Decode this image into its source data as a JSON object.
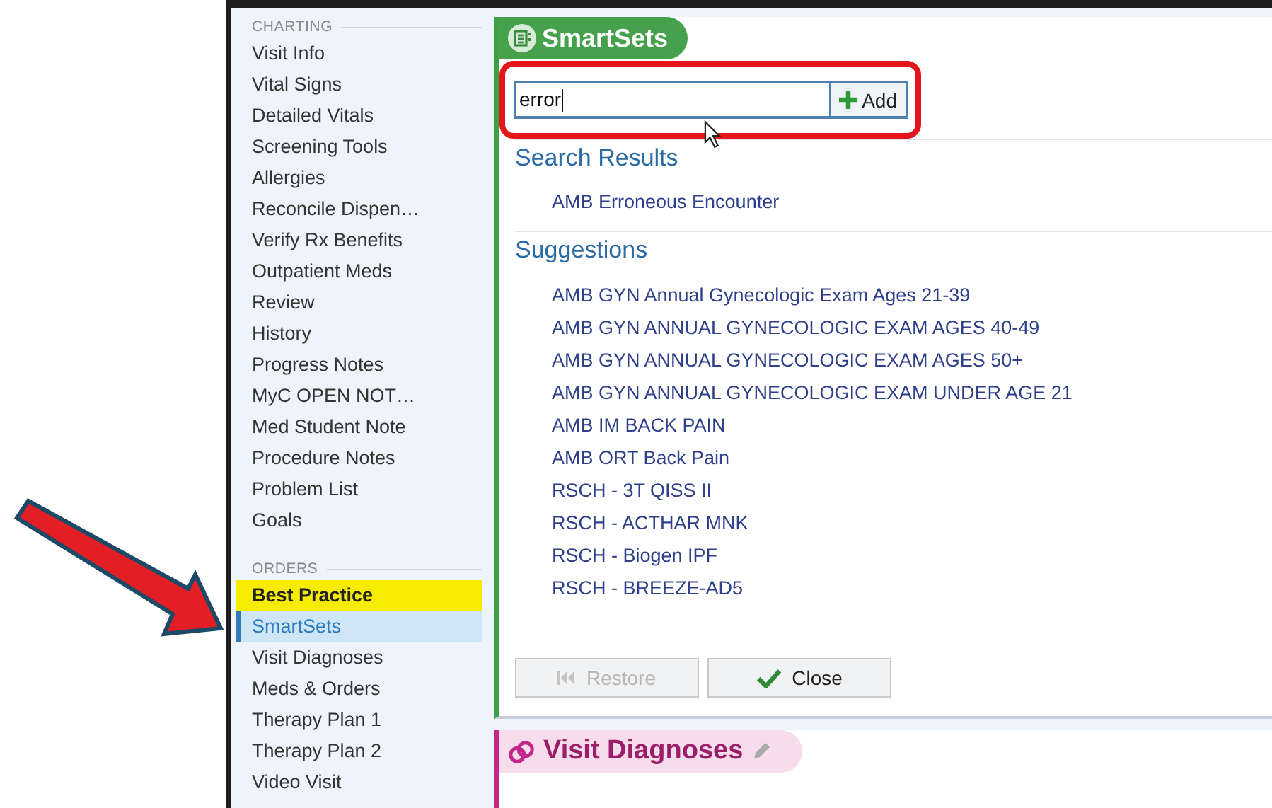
{
  "sidebar": {
    "sections": [
      {
        "title": "CHARTING",
        "items": [
          {
            "label": "Visit Info",
            "selected": false,
            "highlighted": false
          },
          {
            "label": "Vital Signs",
            "selected": false,
            "highlighted": false
          },
          {
            "label": "Detailed Vitals",
            "selected": false,
            "highlighted": false
          },
          {
            "label": "Screening Tools",
            "selected": false,
            "highlighted": false
          },
          {
            "label": "Allergies",
            "selected": false,
            "highlighted": false
          },
          {
            "label": "Reconcile Dispen…",
            "selected": false,
            "highlighted": false
          },
          {
            "label": "Verify Rx Benefits",
            "selected": false,
            "highlighted": false
          },
          {
            "label": "Outpatient Meds",
            "selected": false,
            "highlighted": false
          },
          {
            "label": "Review",
            "selected": false,
            "highlighted": false
          },
          {
            "label": "History",
            "selected": false,
            "highlighted": false
          },
          {
            "label": "Progress Notes",
            "selected": false,
            "highlighted": false
          },
          {
            "label": "MyC OPEN NOT…",
            "selected": false,
            "highlighted": false
          },
          {
            "label": "Med Student Note",
            "selected": false,
            "highlighted": false
          },
          {
            "label": "Procedure Notes",
            "selected": false,
            "highlighted": false
          },
          {
            "label": "Problem List",
            "selected": false,
            "highlighted": false
          },
          {
            "label": "Goals",
            "selected": false,
            "highlighted": false
          }
        ]
      },
      {
        "title": "ORDERS",
        "items": [
          {
            "label": "Best Practice",
            "selected": false,
            "highlighted": true
          },
          {
            "label": "SmartSets",
            "selected": true,
            "highlighted": false
          },
          {
            "label": "Visit Diagnoses",
            "selected": false,
            "highlighted": false
          },
          {
            "label": "Meds & Orders",
            "selected": false,
            "highlighted": false
          },
          {
            "label": "Therapy Plan 1",
            "selected": false,
            "highlighted": false
          },
          {
            "label": "Therapy Plan 2",
            "selected": false,
            "highlighted": false
          },
          {
            "label": "Video Visit",
            "selected": false,
            "highlighted": false
          }
        ]
      }
    ]
  },
  "smartsets": {
    "title": "SmartSets",
    "search": {
      "value": "error",
      "button": "Add"
    },
    "search_results": {
      "heading": "Search Results",
      "items": [
        "AMB Erroneous Encounter"
      ]
    },
    "suggestions": {
      "heading": "Suggestions",
      "items": [
        "AMB GYN Annual Gynecologic Exam Ages 21-39",
        "AMB GYN ANNUAL GYNECOLOGIC EXAM AGES 40-49",
        "AMB GYN ANNUAL GYNECOLOGIC EXAM AGES 50+",
        "AMB GYN ANNUAL GYNECOLOGIC EXAM UNDER AGE 21",
        "AMB IM BACK PAIN",
        "AMB ORT Back Pain",
        "RSCH - 3T QISS II",
        "RSCH - ACTHAR MNK",
        "RSCH - Biogen IPF",
        "RSCH - BREEZE-AD5"
      ]
    },
    "buttons": [
      {
        "kind": "restore",
        "label": "Restore",
        "disabled": true
      },
      {
        "kind": "close",
        "label": "Close",
        "disabled": false
      }
    ]
  },
  "next_section": {
    "title": "Visit Diagnoses"
  }
}
